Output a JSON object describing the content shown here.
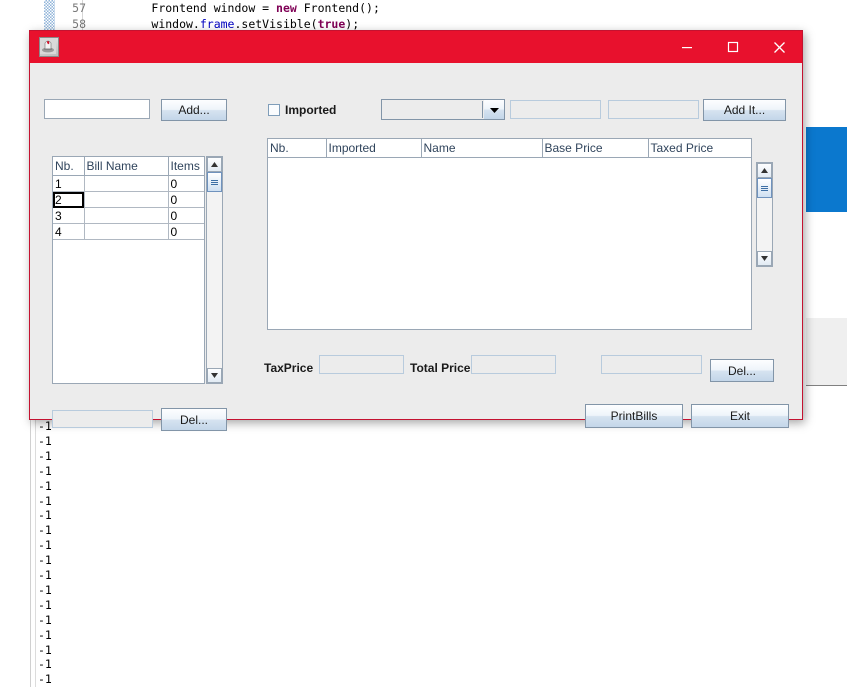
{
  "ide": {
    "code_lines": [
      {
        "number": "57",
        "indent": 30,
        "segments": [
          {
            "t": "Frontend window = ",
            "c": "plain"
          },
          {
            "t": "new",
            "c": "keyword"
          },
          {
            "t": " Frontend();",
            "c": "plain"
          }
        ]
      },
      {
        "number": "58",
        "indent": 30,
        "segments": [
          {
            "t": "window.",
            "c": "plain"
          },
          {
            "t": "frame",
            "c": "field"
          },
          {
            "t": ".setVisible(",
            "c": "plain"
          },
          {
            "t": "true",
            "c": "keyword"
          },
          {
            "t": ");",
            "c": "plain"
          }
        ]
      }
    ],
    "background_blue_color": "#0b78ce"
  },
  "console": {
    "lines": [
      "-1",
      "-1",
      "-1",
      "-1",
      "-1",
      "-1",
      "-1",
      "-1",
      "-1",
      "-1",
      "-1",
      "-1",
      "-1",
      "-1",
      "-1",
      "-1",
      "-1",
      "-1"
    ]
  },
  "dialog": {
    "title": "",
    "titlebar_color": "#e8112d",
    "icon": "java-duke-icon",
    "window_controls": {
      "minimize": "minimize-icon",
      "maximize": "maximize-icon",
      "close": "close-icon"
    },
    "toolbar": {
      "bill_name_input": {
        "value": "",
        "placeholder": ""
      },
      "add_button": "Add...",
      "imported_checkbox": {
        "label": "Imported",
        "checked": false
      },
      "category_combo": {
        "value": "",
        "options": []
      },
      "field_a": {
        "value": "",
        "enabled": false
      },
      "field_b": {
        "value": "",
        "enabled": false
      },
      "add_item_button": "Add It..."
    },
    "bills_table": {
      "columns": [
        "Nb.",
        "Bill Name",
        "Items"
      ],
      "rows": [
        {
          "nb": "1",
          "bill_name": "",
          "items": "0"
        },
        {
          "nb": "2",
          "bill_name": "",
          "items": "0"
        },
        {
          "nb": "3",
          "bill_name": "",
          "items": "0"
        },
        {
          "nb": "4",
          "bill_name": "",
          "items": "0"
        }
      ],
      "selected_row": 1
    },
    "items_table": {
      "columns": [
        "Nb.",
        "Imported",
        "Name",
        "Base Price",
        "Taxed Price"
      ],
      "rows": []
    },
    "totals": {
      "tax_price_label": "TaxPrice",
      "tax_price_value": "",
      "total_price_label": "Total Price",
      "total_price_value": "",
      "item_index_value": "",
      "delete_item_button": "Del..."
    },
    "footer": {
      "bill_index_value": "",
      "delete_bill_button": "Del...",
      "print_bills_button": "PrintBills",
      "exit_button": "Exit"
    }
  }
}
